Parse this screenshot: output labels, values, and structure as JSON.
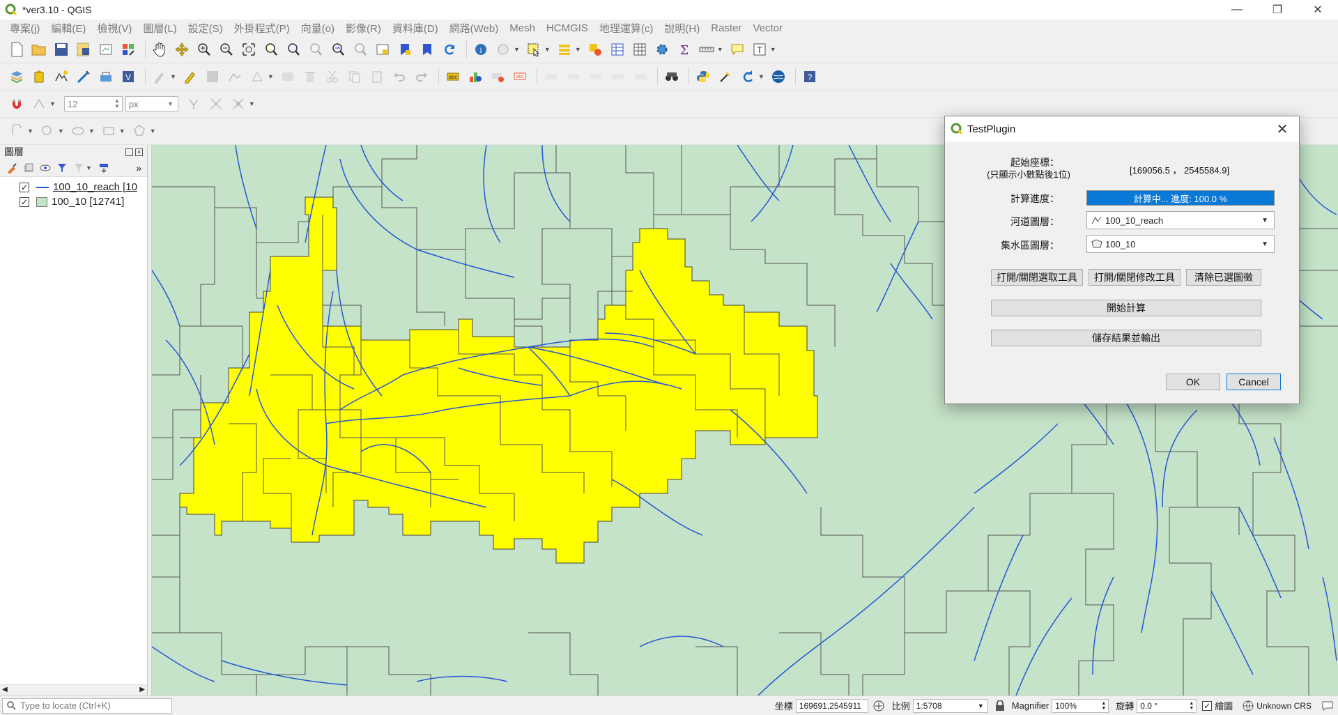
{
  "window": {
    "title": "*ver3.10 - QGIS",
    "controls": {
      "minimize": "—",
      "restore": "❐",
      "close": "✕"
    }
  },
  "menubar": {
    "items": [
      "專案(j)",
      "編輯(E)",
      "檢視(V)",
      "圖層(L)",
      "設定(S)",
      "外掛程式(P)",
      "向量(o)",
      "影像(R)",
      "資料庫(D)",
      "網路(Web)",
      "Mesh",
      "HCMGIS",
      "地理運算(c)",
      "說明(H)",
      "Raster",
      "Vector"
    ]
  },
  "toolbars": {
    "snapping": {
      "tolerance_value": "12",
      "unit_value": "px"
    }
  },
  "layers_panel": {
    "title": "圖層",
    "more_label": "»",
    "layers": [
      {
        "label": "100_10_reach [10",
        "checked": "✓",
        "symbol": "line",
        "color": "#2457d6"
      },
      {
        "label": "100_10 [12741]",
        "checked": "✓",
        "symbol": "fill",
        "color": "#c5e3c8"
      }
    ]
  },
  "map": {
    "background_color": "#c5e3c8",
    "selected_fill_color": "#ffff00",
    "boundary_color": "#555555",
    "stream_color": "#2457d6"
  },
  "dialog": {
    "title": "TestPlugin",
    "close_glyph": "✕",
    "start_coord_label": "起始座標：",
    "start_coord_note": "(只顯示小數點後1位)",
    "start_coord_value": "[169056.5 ， 2545584.9]",
    "progress_label": "計算進度：",
    "progress_text": "計算中... 進度: 100.0 %",
    "progress_fraction": 1.0,
    "reach_layer_label": "河道圖層：",
    "reach_layer_value": "100_10_reach",
    "catchment_layer_label": "集水區圖層：",
    "catchment_layer_value": "100_10",
    "btn_toggle_select": "打開/關閉選取工具",
    "btn_toggle_edit": "打開/關閉修改工具",
    "btn_clear": "清除已選圖徵",
    "btn_start": "開始計算",
    "btn_save": "儲存結果並輸出",
    "btn_ok": "OK",
    "btn_cancel": "Cancel",
    "accent_color": "#0a78d7"
  },
  "statusbar": {
    "locator_placeholder": "Type to locate (Ctrl+K)",
    "coord_label": "坐標",
    "coord_value": "169691,2545911",
    "scale_label": "比例",
    "scale_value": "1:5708",
    "magnifier_label": "Magnifier",
    "magnifier_value": "100%",
    "rotation_label": "旋轉",
    "rotation_value": "0.0 °",
    "render_label": "繪圖",
    "render_checked": "✓",
    "crs_label": "Unknown CRS"
  }
}
